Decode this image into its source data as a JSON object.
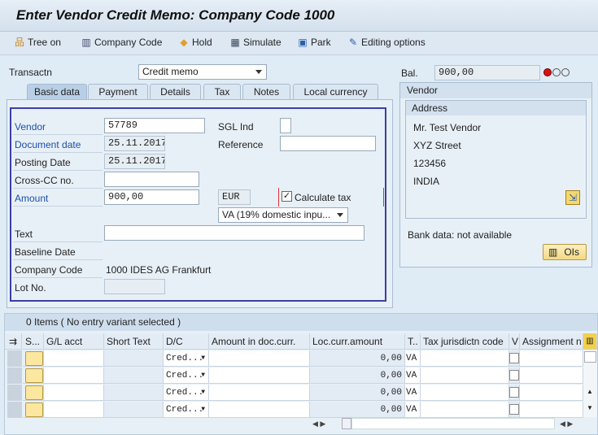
{
  "title": "Enter Vendor Credit Memo: Company Code 1000",
  "toolbar": {
    "tree": "Tree on",
    "company_code": "Company Code",
    "hold": "Hold",
    "simulate": "Simulate",
    "park": "Park",
    "editing": "Editing options"
  },
  "transaction": {
    "label": "Transactn",
    "value": "Credit memo"
  },
  "balance": {
    "label": "Bal.",
    "value": "900,00",
    "status_color": "#e01010"
  },
  "tabs": [
    "Basic data",
    "Payment",
    "Details",
    "Tax",
    "Notes",
    "Local currency"
  ],
  "form": {
    "vendor_label": "Vendor",
    "vendor": "57789",
    "doc_date_label": "Document date",
    "doc_date": "25.11.2017",
    "posting_date_label": "Posting Date",
    "posting_date": "25.11.2017",
    "cross_cc_label": "Cross-CC no.",
    "cross_cc": "",
    "amount_label": "Amount",
    "amount": "900,00",
    "currency": "EUR",
    "calc_tax_label": "Calculate tax",
    "calc_tax": true,
    "tax_code": "VA (19% domestic inpu...",
    "sgl_label": "SGL Ind",
    "sgl": "",
    "reference_label": "Reference",
    "reference": "",
    "text_label": "Text",
    "text": "",
    "baseline_label": "Baseline Date",
    "company_code_label": "Company Code",
    "company_code": "1000 IDES AG Frankfurt",
    "lot_label": "Lot No.",
    "lot": ""
  },
  "vendor_panel": {
    "title": "Vendor",
    "address_title": "Address",
    "address": [
      "Mr. Test Vendor",
      "XYZ Street",
      "123456",
      "INDIA"
    ],
    "bank": "Bank data: not available",
    "ois": "OIs"
  },
  "items": {
    "header": "0 Items ( No entry variant selected )",
    "columns": [
      "S...",
      "G/L acct",
      "Short Text",
      "D/C",
      "Amount in doc.curr.",
      "Loc.curr.amount",
      "T..",
      "Tax jurisdictn code",
      "V",
      "Assignment n"
    ],
    "rows": [
      {
        "dc": "Cred...",
        "loc": "0,00",
        "t": "VA"
      },
      {
        "dc": "Cred...",
        "loc": "0,00",
        "t": "VA"
      },
      {
        "dc": "Cred...",
        "loc": "0,00",
        "t": "VA"
      },
      {
        "dc": "Cred...",
        "loc": "0,00",
        "t": "VA"
      }
    ]
  }
}
